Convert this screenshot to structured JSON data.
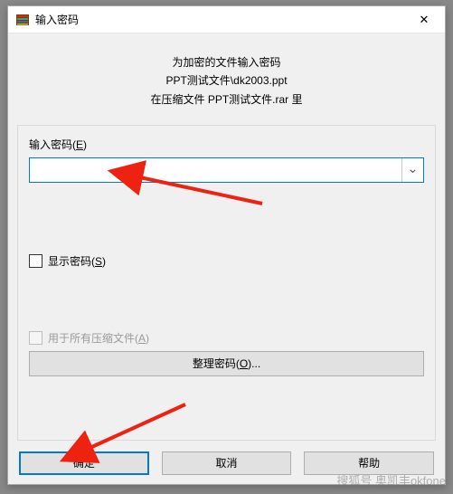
{
  "titlebar": {
    "title": "输入密码",
    "close_glyph": "✕"
  },
  "prompt": {
    "line1": "为加密的文件输入密码",
    "line2": "PPT测试文件\\dk2003.ppt",
    "line3": "在压缩文件 PPT测试文件.rar 里"
  },
  "password": {
    "label_prefix": "输入密码(",
    "label_mnemonic": "E",
    "label_suffix": ")",
    "value": "",
    "dropdown_glyph": "⌄"
  },
  "show_password": {
    "checked": false,
    "label_prefix": "显示密码(",
    "label_mnemonic": "S",
    "label_suffix": ")"
  },
  "use_for_all": {
    "checked": false,
    "enabled": false,
    "label_prefix": "用于所有压缩文件(",
    "label_mnemonic": "A",
    "label_suffix": ")"
  },
  "organize": {
    "label_prefix": "整理密码(",
    "label_mnemonic": "O",
    "label_suffix": ")..."
  },
  "buttons": {
    "ok": "确定",
    "cancel": "取消",
    "help": "帮助"
  },
  "watermark": "搜狐号 奥凯丰okfone"
}
